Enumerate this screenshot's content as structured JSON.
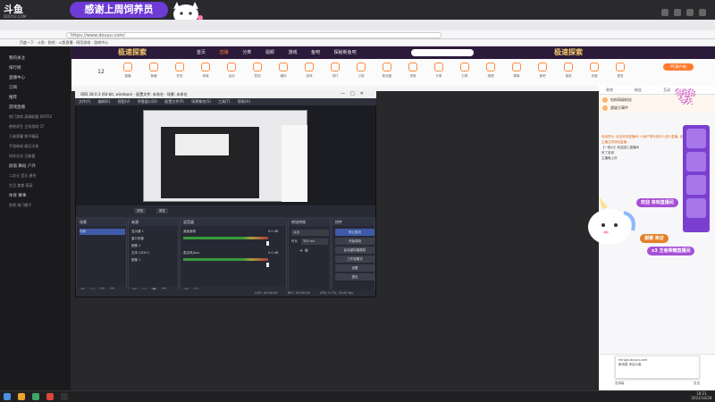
{
  "overlay": {
    "logo": "斗鱼",
    "logo_sub": "DOUYU.COM",
    "banner_text": "感谢上周饲养员"
  },
  "browser": {
    "url": "https://www.douyu.com/",
    "bookmarks": [
      "百度一下",
      "斗鱼",
      "贴吧",
      "斗鱼直播",
      "网页游戏",
      "游戏中心"
    ]
  },
  "site": {
    "nav": [
      "首页",
      "直播",
      "分类",
      "视频",
      "游戏",
      "鱼吧",
      "探秘新鱼吧"
    ],
    "active_nav": 1,
    "game_logo": "极速探索"
  },
  "sidebar": {
    "items": [
      {
        "label": "我的关注",
        "cat": true
      },
      {
        "label": "排行榜",
        "cat": true
      },
      {
        "label": "直播中心",
        "cat": true
      },
      {
        "label": "订阅",
        "cat": true
      },
      {
        "label": "推荐",
        "cat": true
      },
      {
        "label": "游戏直播",
        "cat": true
      },
      {
        "label": "热门游戏 英雄联盟 DOTA2",
        "cat": false
      },
      {
        "label": "绝地求生 主机游戏 CF",
        "cat": false
      },
      {
        "label": "王者荣耀 和平精英",
        "cat": false
      },
      {
        "label": "手游休闲 娱乐天地",
        "cat": false
      },
      {
        "label": "科技文化 正能量",
        "cat": false
      },
      {
        "label": "颜值 舞蹈 户外",
        "cat": true
      },
      {
        "label": "二次元 音乐 星秀",
        "cat": false
      },
      {
        "label": "生活 美食 萌宠",
        "cat": false
      },
      {
        "label": "体育 赛事",
        "cat": true
      },
      {
        "label": "鱼吧 热门圈子",
        "cat": false
      }
    ]
  },
  "icon_bar": {
    "date": "12",
    "items": [
      "直播",
      "鱼塘",
      "任务",
      "商城",
      "活动",
      "签到",
      "福利",
      "游戏",
      "排行",
      "订阅",
      "粉丝团",
      "贵族",
      "头条",
      "分类",
      "视频",
      "赛事",
      "鱼吧",
      "抽奖",
      "充值",
      "更多"
    ],
    "right_button": "PC客户端"
  },
  "obs": {
    "title": "OBS 28.0.3 (64-bit, windows) - 配置文件: 未命名 - 场景: 未命名",
    "menu": [
      "文件(F)",
      "编辑(E)",
      "视图(V)",
      "停靠窗口(D)",
      "配置文件(P)",
      "场景集合(S)",
      "工具(T)",
      "帮助(H)"
    ],
    "toolbar": {
      "filters": "滤镜",
      "properties": "属性"
    },
    "docks": {
      "scenes": {
        "title": "场景",
        "items": [
          "场景"
        ]
      },
      "sources": {
        "title": "来源",
        "items": [
          "显示器 1",
          "窗口采集",
          "图像 2",
          "文本 (GDI+)",
          "图像 1"
        ]
      },
      "mixer": {
        "title": "混音器",
        "channels": [
          {
            "name": "桌面音频",
            "db": "0.0 dB"
          },
          {
            "name": "麦克风/Aux",
            "db": "0.0 dB"
          }
        ]
      },
      "transitions": {
        "title": "转场特效",
        "type": "淡出",
        "duration_label": "时长",
        "duration": "300 ms"
      },
      "controls": {
        "title": "控件",
        "buttons": [
          "停止推流",
          "开始录制",
          "启动虚拟摄像机",
          "工作室模式",
          "设置",
          "退出"
        ]
      }
    },
    "status": {
      "live": "LIVE: 00:00:00",
      "rec": "REC: 00:00:00",
      "cpu": "CPU: 0.7%, 30.00 fps"
    }
  },
  "chat": {
    "tabs": [
      "贵宾",
      "粉丝",
      "互动"
    ],
    "rank": [
      {
        "name": "钻粉高级粉丝",
        "value": "1"
      },
      {
        "name": "超级大事件",
        "value": "2"
      }
    ],
    "messages": [
      "系统提示: 欢迎来到直播间! 斗鱼严禁未成年人进行直播, 请主播注意绿色直播...",
      "【一团火】欢迎进入直播间",
      "来了老弟",
      "主播晚上好"
    ],
    "input_placeholder": "发弹幕",
    "notif_title": "mingxi.douyu.com",
    "notif_body": "新消息 来自斗鱼",
    "send_label": "发送"
  },
  "decor": {
    "corner_banner_1": "你也有",
    "corner_banner_2": "今天",
    "welcome_1": "欢迎 来到直播间",
    "welcome_2": "谢谢 来访",
    "welcome_3": "x3 王者荣耀直播间"
  },
  "taskbar": {
    "time": "18:21",
    "date": "2022/10/28"
  },
  "colors": {
    "accent": "#ff7a2e",
    "obs_bg": "#2b2e38",
    "obs_primary": "#3e5aa8",
    "overlay_purple": "#6f3bd6"
  }
}
